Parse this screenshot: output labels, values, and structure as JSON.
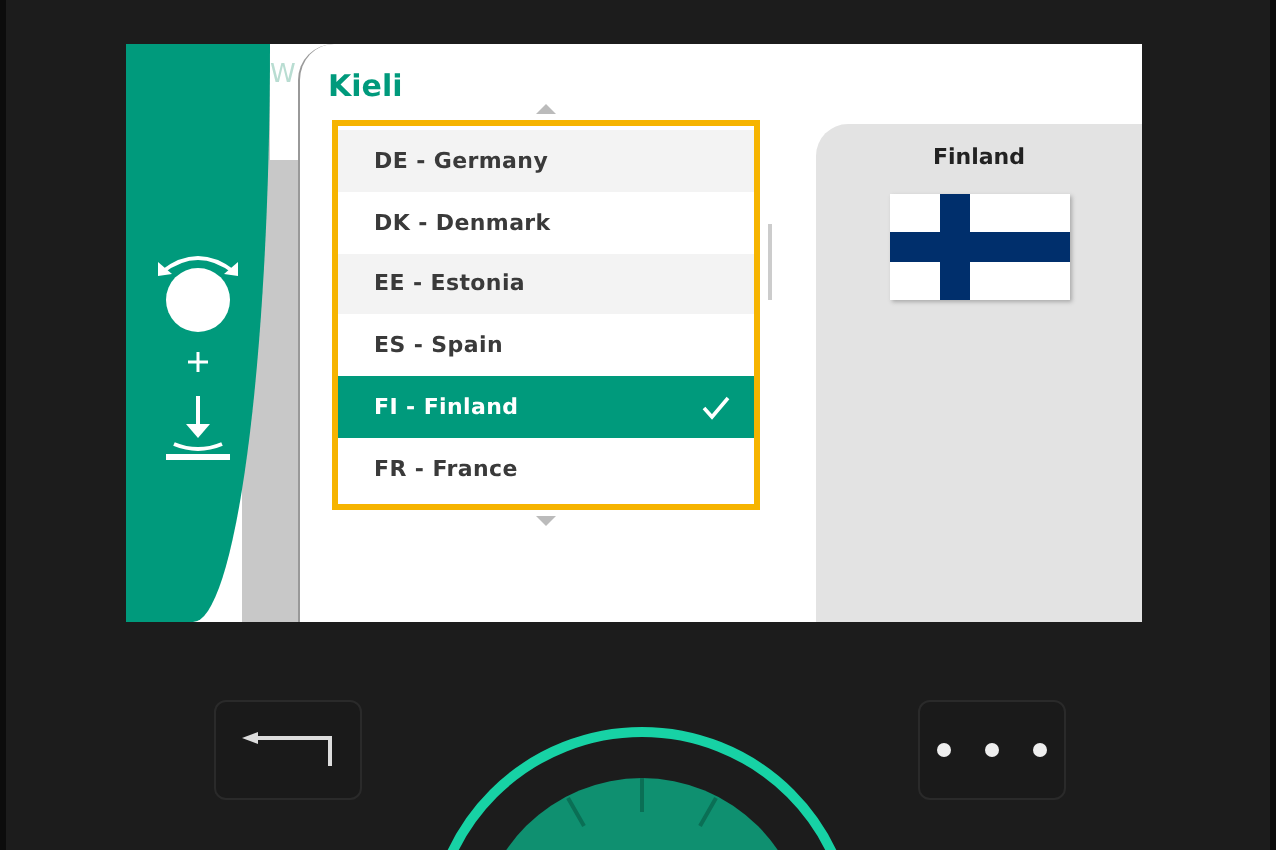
{
  "background_tab": {
    "title": "W"
  },
  "dialog": {
    "title": "Kieli",
    "languages": [
      {
        "label": "DE - Germany",
        "selected": false
      },
      {
        "label": "DK - Denmark",
        "selected": false
      },
      {
        "label": "EE - Estonia",
        "selected": false
      },
      {
        "label": "ES - Spain",
        "selected": false
      },
      {
        "label": "FI - Finland",
        "selected": true
      },
      {
        "label": "FR - France",
        "selected": false
      }
    ]
  },
  "preview": {
    "title": "Finland"
  }
}
